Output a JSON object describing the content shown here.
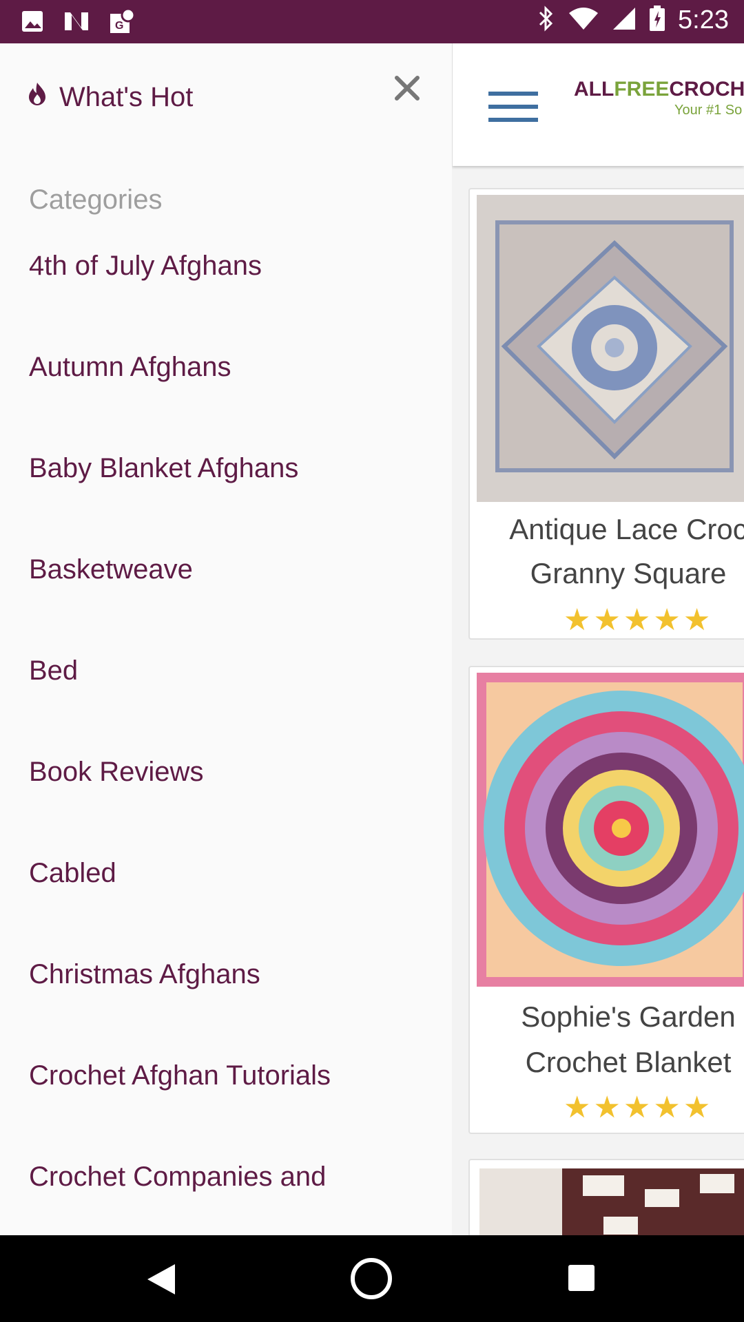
{
  "status_bar": {
    "time": "5:23",
    "left_icons": [
      "image-icon",
      "news-icon",
      "maps-icon"
    ],
    "right_icons": [
      "bluetooth-icon",
      "wifi-icon",
      "signal-icon",
      "battery-icon"
    ]
  },
  "drawer": {
    "whats_hot": "What's Hot",
    "categories_label": "Categories",
    "items": [
      "4th of July Afghans",
      "Autumn Afghans",
      "Baby Blanket Afghans",
      "Basketweave",
      "Bed",
      "Book Reviews",
      "Cabled",
      "Christmas Afghans",
      "Crochet Afghan Tutorials",
      "Crochet Companies and"
    ]
  },
  "header": {
    "logo_part1": "ALL",
    "logo_part2": "FREE",
    "logo_part3": "CROCH",
    "tagline": "Your #1 So"
  },
  "cards": [
    {
      "title_line1": "Antique Lace Croc",
      "title_line2": "Granny Square",
      "rating": 5
    },
    {
      "title_line1": "Sophie's Garden",
      "title_line2": "Crochet Blanket",
      "rating": 5
    }
  ],
  "colors": {
    "brand": "#5e1b45",
    "accent_blue": "#3f6fa0",
    "star": "#f2c12e"
  }
}
